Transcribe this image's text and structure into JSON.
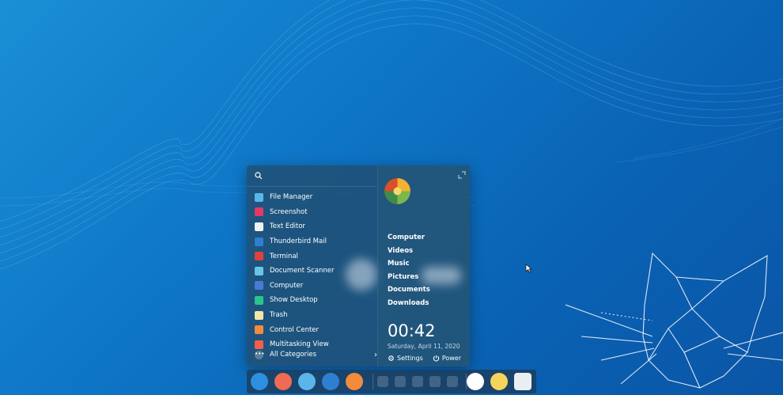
{
  "apps": [
    {
      "label": "File Manager",
      "icon": "file-manager-icon",
      "color": "#5ab6ea"
    },
    {
      "label": "Screenshot",
      "icon": "screenshot-icon",
      "color": "#e23a63"
    },
    {
      "label": "Text Editor",
      "icon": "text-editor-icon",
      "color": "#f1f1f1"
    },
    {
      "label": "Thunderbird Mail",
      "icon": "thunderbird-mail-icon",
      "color": "#2f7fd1"
    },
    {
      "label": "Terminal",
      "icon": "terminal-icon",
      "color": "#e0413d"
    },
    {
      "label": "Document Scanner",
      "icon": "document-scanner-icon",
      "color": "#67c6e8"
    },
    {
      "label": "Computer",
      "icon": "computer-icon",
      "color": "#4a79d8"
    },
    {
      "label": "Show Desktop",
      "icon": "show-desktop-icon",
      "color": "#2bc48a"
    },
    {
      "label": "Trash",
      "icon": "trash-icon",
      "color": "#f3e6a8"
    },
    {
      "label": "Control Center",
      "icon": "control-center-icon",
      "color": "#f28b3c"
    },
    {
      "label": "Multitasking View",
      "icon": "multitasking-view-icon",
      "color": "#f0604a"
    }
  ],
  "all_categories": "All Categories",
  "places": [
    "Computer",
    "Videos",
    "Music",
    "Pictures",
    "Documents",
    "Downloads"
  ],
  "clock": "00:42",
  "date": "Saturday, April 11, 2020",
  "settings_label": "Settings",
  "power_label": "Power",
  "colors": {
    "accent": "#1a8fd6",
    "panel": "#214e70"
  },
  "dock": [
    {
      "icon": "launcher-icon",
      "color": "#2d8fe0"
    },
    {
      "icon": "multitasking-icon",
      "color": "#f06a56"
    },
    {
      "icon": "file-manager-icon",
      "color": "#5ab6ea"
    },
    {
      "icon": "thunderbird-icon",
      "color": "#2f7fd1"
    },
    {
      "icon": "settings-icon",
      "color": "#f28b3c"
    }
  ],
  "tray": [
    "notification-icon",
    "volume-icon",
    "pen-icon",
    "keyboard-icon",
    "collapse-arrow-icon"
  ],
  "dock_right": [
    {
      "icon": "power-icon",
      "color": "#ffffff"
    },
    {
      "icon": "clock-icon",
      "color": "#f5d45b"
    },
    {
      "icon": "trash-icon",
      "color": "#e9eef2"
    }
  ]
}
